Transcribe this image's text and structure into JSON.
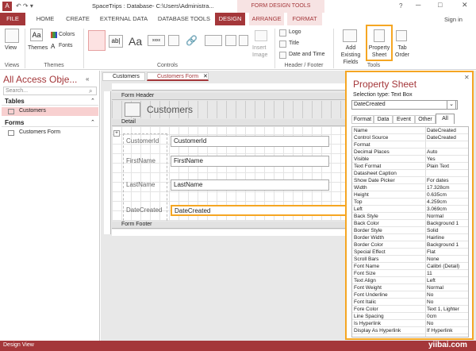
{
  "window": {
    "title": "SpaceTrips : Database- C:\\Users\\Administra...",
    "context_tab": "FORM DESIGN TOOLS",
    "help": "?",
    "signin": "Sign in"
  },
  "tabs": [
    "FILE",
    "HOME",
    "CREATE",
    "EXTERNAL DATA",
    "DATABASE TOOLS",
    "DESIGN",
    "ARRANGE",
    "FORMAT"
  ],
  "ribbon": {
    "view_label": "View",
    "views_group": "Views",
    "themes_label": "Themes",
    "colors_label": "Colors",
    "fonts_label": "Fonts",
    "themes_group": "Themes",
    "controls_group": "Controls",
    "insert_image": "Insert Image",
    "logo": "Logo",
    "title": "Title",
    "date_time": "Date and Time",
    "header_footer_group": "Header / Footer",
    "add_fields": "Add Existing Fields",
    "property_sheet": "Property Sheet",
    "tab_order": "Tab Order",
    "tools_group": "Tools"
  },
  "nav": {
    "title": "All Access Obje...",
    "search_placeholder": "Search...",
    "sections": [
      {
        "name": "Tables",
        "items": [
          "Customers"
        ]
      },
      {
        "name": "Forms",
        "items": [
          "Customers Form"
        ]
      }
    ]
  },
  "doc_tabs": [
    "Customers",
    "Customers Form"
  ],
  "form": {
    "header_section": "Form Header",
    "header_title": "Customers",
    "detail_section": "Detail",
    "footer_section": "Form Footer",
    "fields": [
      {
        "label": "CustomerId",
        "box": "CustomerId"
      },
      {
        "label": "FirstName",
        "box": "FirstName"
      },
      {
        "label": "LastName",
        "box": "LastName"
      },
      {
        "label": "DateCreated",
        "box": "DateCreated"
      }
    ]
  },
  "property_sheet": {
    "title": "Property Sheet",
    "selection_type": "Selection type:  Text Box",
    "selected": "DateCreated",
    "tabs": [
      "Format",
      "Data",
      "Event",
      "Other",
      "All"
    ],
    "rows": [
      [
        "Name",
        "DateCreated"
      ],
      [
        "Control Source",
        "DateCreated"
      ],
      [
        "Format",
        ""
      ],
      [
        "Decimal Places",
        "Auto"
      ],
      [
        "Visible",
        "Yes"
      ],
      [
        "Text Format",
        "Plain Text"
      ],
      [
        "Datasheet Caption",
        ""
      ],
      [
        "Show Date Picker",
        "For dates"
      ],
      [
        "Width",
        "17.328cm"
      ],
      [
        "Height",
        "0.635cm"
      ],
      [
        "Top",
        "4.259cm"
      ],
      [
        "Left",
        "3.069cm"
      ],
      [
        "Back Style",
        "Normal"
      ],
      [
        "Back Color",
        "Background 1"
      ],
      [
        "Border Style",
        "Solid"
      ],
      [
        "Border Width",
        "Hairline"
      ],
      [
        "Border Color",
        "Background 1"
      ],
      [
        "Special Effect",
        "Flat"
      ],
      [
        "Scroll Bars",
        "None"
      ],
      [
        "Font Name",
        "Calibri (Detail)"
      ],
      [
        "Font Size",
        "11"
      ],
      [
        "Text Align",
        "Left"
      ],
      [
        "Font Weight",
        "Normal"
      ],
      [
        "Font Underline",
        "No"
      ],
      [
        "Font Italic",
        "No"
      ],
      [
        "Fore Color",
        "Text 1, Lighter"
      ],
      [
        "Line Spacing",
        "0cm"
      ],
      [
        "Is Hyperlink",
        "No"
      ],
      [
        "Display As Hyperlink",
        "If Hyperlink"
      ]
    ]
  },
  "status": {
    "left": "Design View",
    "watermark": "yiibai.com"
  },
  "colors": {
    "accent": "#a4373a",
    "highlight": "#f5a623",
    "nav_title": "#a4373a"
  }
}
